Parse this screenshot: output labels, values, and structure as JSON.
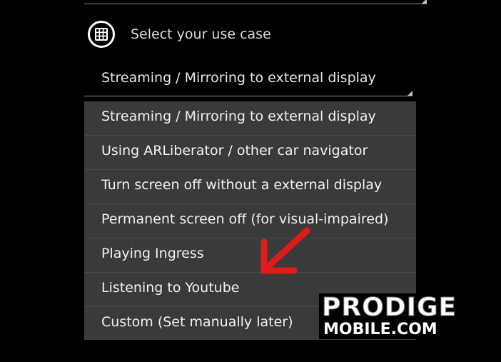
{
  "header": {
    "label": "Select your use case",
    "icon": "app-grid-icon"
  },
  "spinner": {
    "selected": "Streaming / Mirroring to external display"
  },
  "options": [
    "Streaming / Mirroring to external display",
    "Using ARLiberator / other car navigator",
    "Turn screen off without a external display",
    "Permanent screen off (for visual-impaired)",
    "Playing Ingress",
    "Listening to Youtube",
    "Custom (Set manually later)"
  ],
  "watermark": {
    "line1": "PRODIGE",
    "line2": "MOBILE.COM"
  },
  "colors": {
    "background": "#000000",
    "dropdown": "#3a3a3a",
    "arrow": "#e01b1b"
  }
}
